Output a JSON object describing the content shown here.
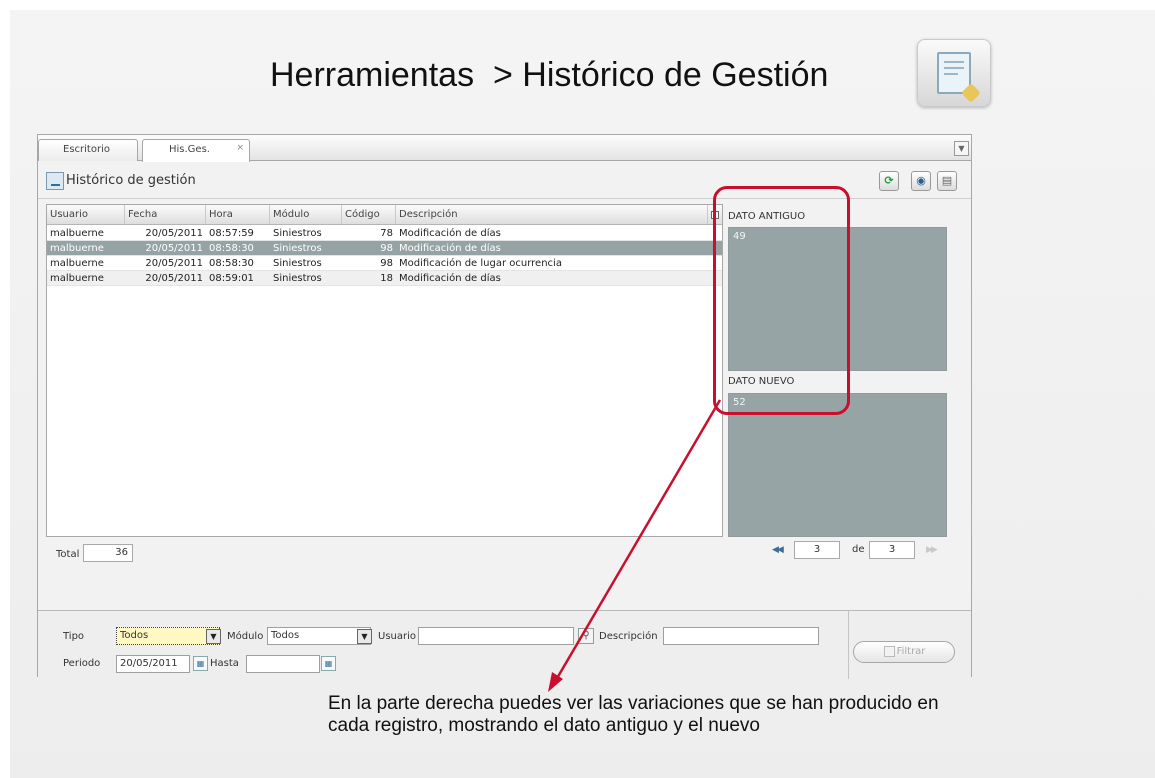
{
  "heading": {
    "text": "Herramientas  > Histórico de Gestión",
    "icon": "document-edit-icon"
  },
  "tabs": [
    {
      "label": "Escritorio"
    },
    {
      "label": "His.Ges.",
      "close": "×"
    }
  ],
  "tab_menu_arrow": "▼",
  "panel": {
    "title": "Histórico de gestión"
  },
  "toolbar": {
    "refresh_icon": "refresh-icon",
    "view_icon": "eye-icon",
    "print_icon": "print-icon"
  },
  "grid": {
    "columns": [
      "Usuario",
      "Fecha",
      "Hora",
      "Módulo",
      "Código",
      "Descripción"
    ],
    "rows": [
      [
        "malbuerne",
        "20/05/2011",
        "08:57:59",
        "Siniestros",
        "78",
        "Modificación de días"
      ],
      [
        "malbuerne",
        "20/05/2011",
        "08:58:30",
        "Siniestros",
        "98",
        "Modificación de días"
      ],
      [
        "malbuerne",
        "20/05/2011",
        "08:58:30",
        "Siniestros",
        "98",
        "Modificación de lugar ocurrencia"
      ],
      [
        "malbuerne",
        "20/05/2011",
        "08:59:01",
        "Siniestros",
        "18",
        "Modificación de días"
      ]
    ],
    "selected_row": 1
  },
  "total": {
    "label": "Total",
    "value": "36"
  },
  "detail": {
    "old_label": "DATO ANTIGUO",
    "old_value": "49",
    "new_label": "DATO NUEVO",
    "new_value": "52"
  },
  "pager": {
    "first": "◀◀",
    "current": "3",
    "of_label": "de",
    "total": "3",
    "last": "▶▶"
  },
  "filters": {
    "tipo_label": "Tipo",
    "tipo_value": "Todos",
    "modulo_label": "Módulo",
    "modulo_value": "Todos",
    "usuario_label": "Usuario",
    "usuario_value": "",
    "descripcion_label": "Descripción",
    "descripcion_value": "",
    "periodo_label": "Periodo",
    "periodo_value": "20/05/2011",
    "hasta_label": "Hasta",
    "hasta_value": "",
    "filter_button": "Filtrar",
    "select_arrow": "▼",
    "calendar_glyph": "▦",
    "search_glyph": "⚲"
  },
  "caption": "En la parte derecha puedes ver las variaciones que se han producido en cada registro, mostrando el dato antiguo y el nuevo",
  "colors": {
    "selection": "#95a3a5",
    "callout": "#c8102e"
  }
}
